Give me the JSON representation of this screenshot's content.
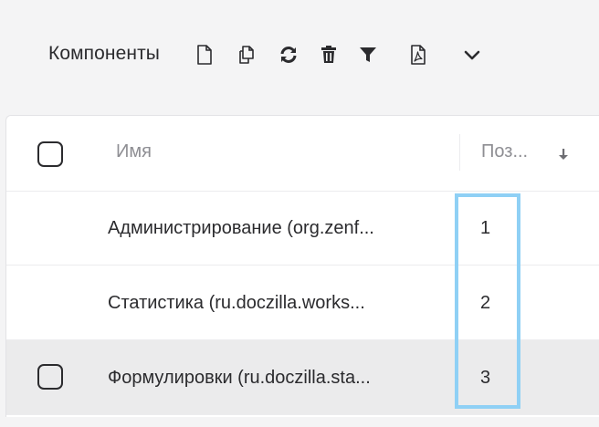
{
  "toolbar": {
    "title": "Компоненты",
    "icons": [
      "new-document-icon",
      "copy-icon",
      "refresh-icon",
      "delete-icon",
      "filter-icon",
      "pdf-icon",
      "chevron-down-icon"
    ]
  },
  "grid": {
    "columns": [
      {
        "key": "name",
        "label": "Имя"
      },
      {
        "key": "position",
        "label": "Поз..."
      }
    ],
    "sort": {
      "column": "position",
      "direction": "desc"
    },
    "rows": [
      {
        "name": "Администрирование (org.zenf...",
        "position": "1",
        "selected": false
      },
      {
        "name": "Статистика (ru.doczilla.works...",
        "position": "2",
        "selected": false
      },
      {
        "name": "Формулировки (ru.doczilla.sta...",
        "position": "3",
        "selected": true
      }
    ]
  },
  "colors": {
    "highlight": "#8fd0f5",
    "text": "#2b2b2e",
    "muted": "#8e8e93",
    "selected_row": "#ebebec"
  }
}
